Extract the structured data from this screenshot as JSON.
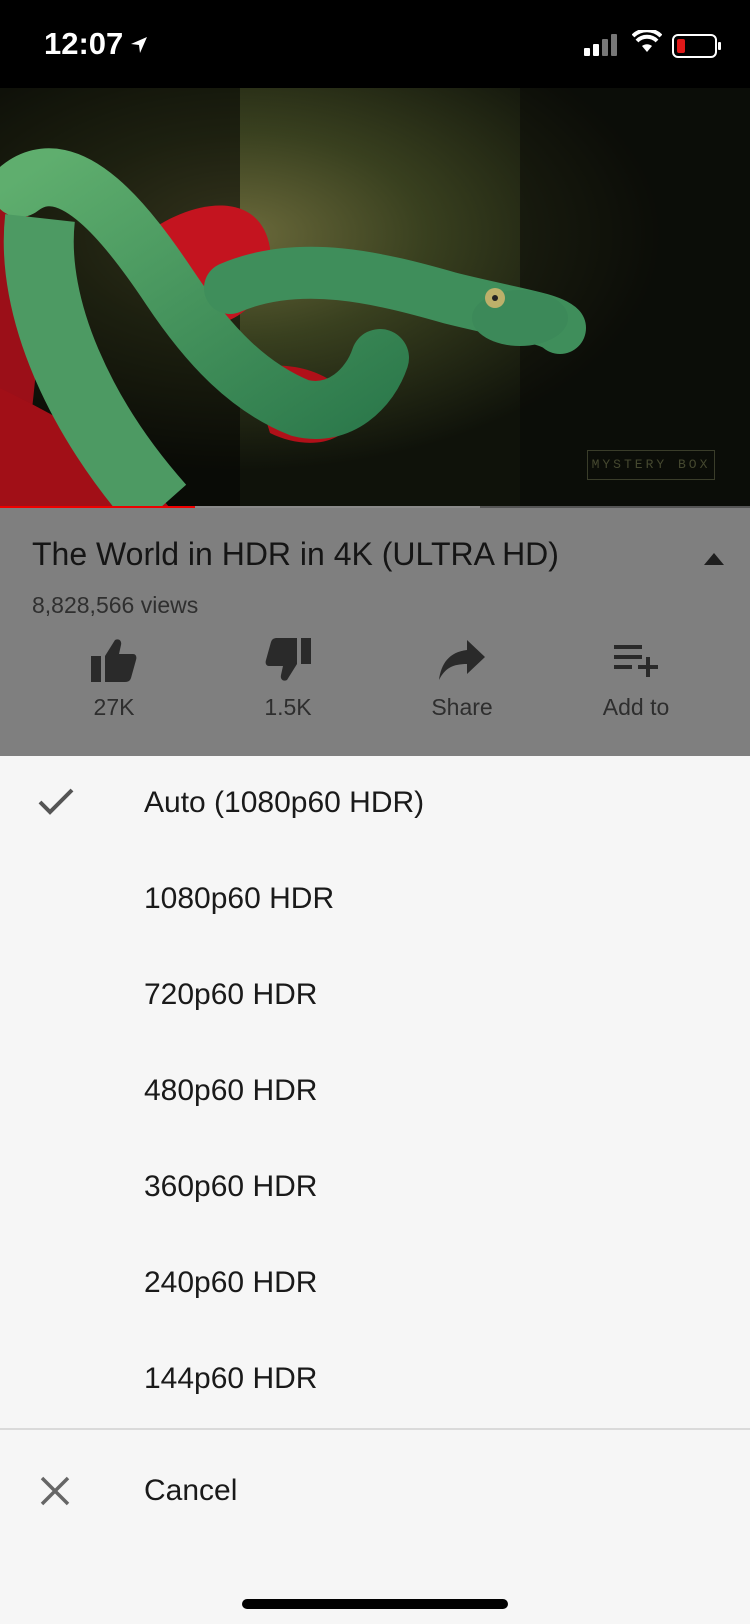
{
  "status_bar": {
    "time": "12:07"
  },
  "video": {
    "watermark": "MYSTERY BOX",
    "progress_fraction": 0.26,
    "buffer_fraction": 0.64
  },
  "info": {
    "title": "The World in HDR in 4K (ULTRA HD)",
    "views": "8,828,566 views",
    "actions": [
      {
        "icon": "thumbs-up-icon",
        "label": "27K"
      },
      {
        "icon": "thumbs-down-icon",
        "label": "1.5K"
      },
      {
        "icon": "share-icon",
        "label": "Share"
      },
      {
        "icon": "add-to-playlist-icon",
        "label": "Add to"
      }
    ]
  },
  "quality_menu": {
    "selected_index": 0,
    "options": [
      {
        "label": "Auto (1080p60 HDR)"
      },
      {
        "label": "1080p60 HDR"
      },
      {
        "label": "720p60 HDR"
      },
      {
        "label": "480p60 HDR"
      },
      {
        "label": "360p60 HDR"
      },
      {
        "label": "240p60 HDR"
      },
      {
        "label": "144p60 HDR"
      }
    ],
    "cancel_label": "Cancel"
  },
  "colors": {
    "progress": "#ee0000",
    "dim_overlay": "#7f7f7f",
    "sheet_bg": "#f6f6f6"
  }
}
